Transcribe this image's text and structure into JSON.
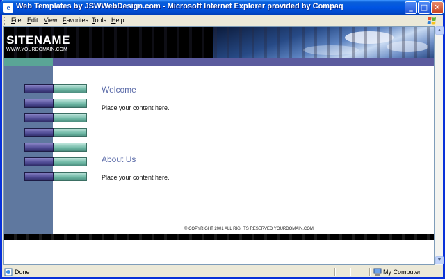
{
  "window": {
    "title": "Web Templates by JSWWebDesign.com - Microsoft Internet Explorer provided by Compaq",
    "minimize_label": "_",
    "maximize_label": "□",
    "close_label": "✕"
  },
  "menu": {
    "items": [
      {
        "label": "File",
        "accel": "F",
        "rest": "ile"
      },
      {
        "label": "Edit",
        "accel": "E",
        "rest": "dit"
      },
      {
        "label": "View",
        "accel": "V",
        "rest": "iew"
      },
      {
        "label": "Favorites",
        "accel": "F",
        "rest": "avorites"
      },
      {
        "label": "Tools",
        "accel": "T",
        "rest": "ools"
      },
      {
        "label": "Help",
        "accel": "H",
        "rest": "elp"
      }
    ]
  },
  "page": {
    "site_name": "SITENAME",
    "site_url": "WWW.YOURDOMAIN.COM",
    "nav_buttons": 7,
    "sections": [
      {
        "title": "Welcome",
        "body": "Place your content here."
      },
      {
        "title": "About Us",
        "body": "Place your content here."
      }
    ],
    "footer": "© COPYRIGHT 2001 ALL RIGHTS RESERVED YOURDOMAIN.COM"
  },
  "status": {
    "text": "Done",
    "zone": "My Computer"
  },
  "colors": {
    "titlebar": "#0054e3",
    "sidebar": "#5f789f",
    "nav_strip": "#5b5b9e",
    "teal": "#5aa596",
    "heading": "#5a6aa8"
  }
}
